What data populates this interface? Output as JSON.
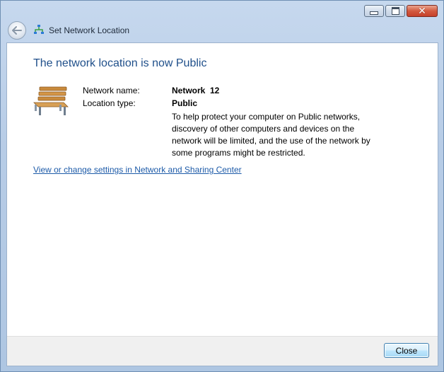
{
  "window": {
    "title": "Set Network Location"
  },
  "content": {
    "heading": "The network location is now Public",
    "network_name_label": "Network name:",
    "network_name_value": "Network  12",
    "location_type_label": "Location type:",
    "location_type_value": "Public",
    "description": "To help protect your computer on Public networks, discovery of other computers and devices on the network will be limited, and the use of the network by some programs might be restricted.",
    "link": "View or change settings in Network and Sharing Center"
  },
  "footer": {
    "close_label": "Close"
  },
  "colors": {
    "heading": "#1f4f8a",
    "link": "#1c5aa8",
    "close_caption": "#c5402a"
  },
  "icons": {
    "title": "network-icon",
    "location": "park-bench-icon",
    "back": "back-arrow-icon"
  }
}
